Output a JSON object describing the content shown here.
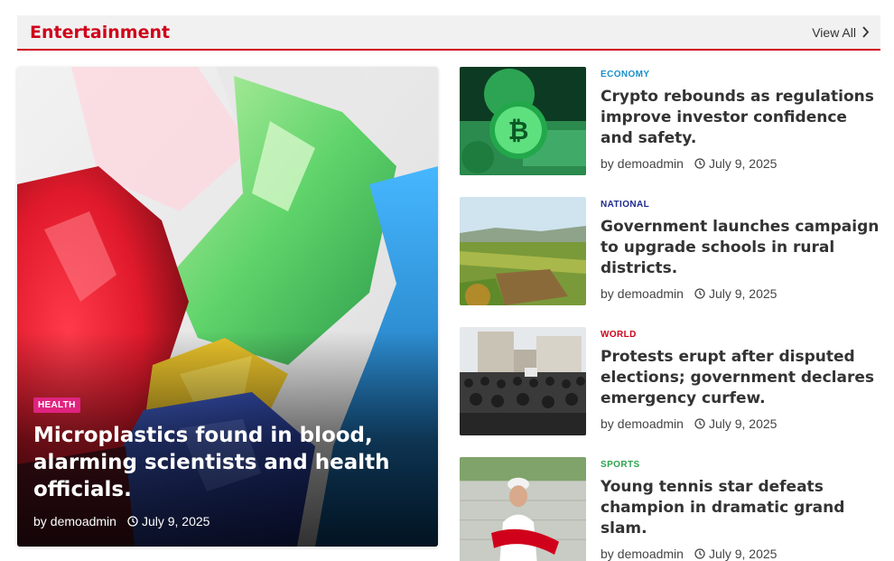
{
  "section": {
    "title": "Entertainment",
    "view_all": "View All"
  },
  "featured": {
    "category": "HEALTH",
    "category_color": "#e0237f",
    "title": "Microplastics found in blood, alarming scientists and health officials.",
    "author_prefix": "by",
    "author": "demoadmin",
    "date": "July 9, 2025"
  },
  "items": [
    {
      "category": "ECONOMY",
      "category_color": "#1a8fc7",
      "title": "Crypto rebounds as regulations improve investor confidence and safety.",
      "author_prefix": "by",
      "author": "demoadmin",
      "date": "July 9, 2025"
    },
    {
      "category": "NATIONAL",
      "category_color": "#1f2a8f",
      "title": "Government launches campaign to upgrade schools in rural districts.",
      "author_prefix": "by",
      "author": "demoadmin",
      "date": "July 9, 2025"
    },
    {
      "category": "WORLD",
      "category_color": "#d0021b",
      "title": "Protests erupt after disputed elections; government declares emergency curfew.",
      "author_prefix": "by",
      "author": "demoadmin",
      "date": "July 9, 2025"
    },
    {
      "category": "SPORTS",
      "category_color": "#2ea44f",
      "title": "Young tennis star defeats champion in dramatic grand slam.",
      "author_prefix": "by",
      "author": "demoadmin",
      "date": "July 9, 2025"
    }
  ],
  "colors": {
    "accent": "#d0021b",
    "header_bg": "#f1f1f1"
  }
}
